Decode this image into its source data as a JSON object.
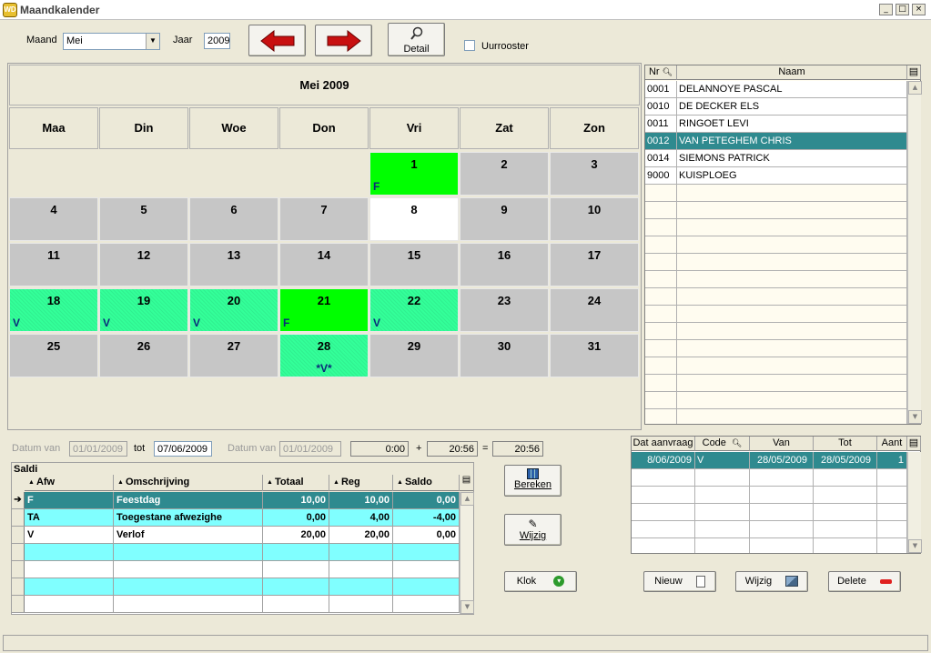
{
  "window": {
    "title": "Maandkalender",
    "min": "_",
    "max": "□",
    "close": "×"
  },
  "toolbar": {
    "maand_label": "Maand",
    "maand_value": "Mei",
    "jaar_label": "Jaar",
    "jaar_value": "2009",
    "detail_label": "Detail",
    "uurrooster_label": "Uurrooster",
    "uurrooster_checked": false
  },
  "calendar": {
    "month_title": "Mei 2009",
    "day_headers": [
      "Maa",
      "Din",
      "Woe",
      "Don",
      "Vri",
      "Zat",
      "Zon"
    ],
    "weeks": [
      [
        {
          "d": "",
          "s": "empty",
          "m": ""
        },
        {
          "d": "",
          "s": "empty",
          "m": ""
        },
        {
          "d": "",
          "s": "empty",
          "m": ""
        },
        {
          "d": "",
          "s": "empty",
          "m": ""
        },
        {
          "d": "1",
          "s": "green",
          "m": "F"
        },
        {
          "d": "2",
          "s": "gray",
          "m": ""
        },
        {
          "d": "3",
          "s": "gray",
          "m": ""
        }
      ],
      [
        {
          "d": "4",
          "s": "gray",
          "m": ""
        },
        {
          "d": "5",
          "s": "gray",
          "m": ""
        },
        {
          "d": "6",
          "s": "gray",
          "m": ""
        },
        {
          "d": "7",
          "s": "gray",
          "m": ""
        },
        {
          "d": "8",
          "s": "white",
          "m": ""
        },
        {
          "d": "9",
          "s": "gray",
          "m": ""
        },
        {
          "d": "10",
          "s": "gray",
          "m": ""
        }
      ],
      [
        {
          "d": "11",
          "s": "gray",
          "m": ""
        },
        {
          "d": "12",
          "s": "gray",
          "m": ""
        },
        {
          "d": "13",
          "s": "gray",
          "m": ""
        },
        {
          "d": "14",
          "s": "gray",
          "m": ""
        },
        {
          "d": "15",
          "s": "gray",
          "m": ""
        },
        {
          "d": "16",
          "s": "gray",
          "m": ""
        },
        {
          "d": "17",
          "s": "gray",
          "m": ""
        }
      ],
      [
        {
          "d": "18",
          "s": "hatch",
          "m": "V"
        },
        {
          "d": "19",
          "s": "hatch",
          "m": "V"
        },
        {
          "d": "20",
          "s": "hatch",
          "m": "V"
        },
        {
          "d": "21",
          "s": "green",
          "m": "F"
        },
        {
          "d": "22",
          "s": "hatch",
          "m": "V"
        },
        {
          "d": "23",
          "s": "gray",
          "m": ""
        },
        {
          "d": "24",
          "s": "gray",
          "m": ""
        }
      ],
      [
        {
          "d": "25",
          "s": "gray",
          "m": ""
        },
        {
          "d": "26",
          "s": "gray",
          "m": ""
        },
        {
          "d": "27",
          "s": "gray",
          "m": ""
        },
        {
          "d": "28",
          "s": "hatch center",
          "m": "*V*"
        },
        {
          "d": "29",
          "s": "gray",
          "m": ""
        },
        {
          "d": "30",
          "s": "gray",
          "m": ""
        },
        {
          "d": "31",
          "s": "gray",
          "m": ""
        }
      ]
    ]
  },
  "employees": {
    "col_nr": "Nr",
    "col_naam": "Naam",
    "rows": [
      {
        "nr": "0001",
        "naam": "DELANNOYE PASCAL"
      },
      {
        "nr": "0010",
        "naam": "DE DECKER ELS"
      },
      {
        "nr": "0011",
        "naam": "RINGOET LEVI"
      },
      {
        "nr": "0012",
        "naam": "VAN PETEGHEM CHRIS"
      },
      {
        "nr": "0014",
        "naam": "SIEMONS PATRICK"
      },
      {
        "nr": "9000",
        "naam": "KUISPLOEG"
      }
    ],
    "selected_index": 3
  },
  "dates": {
    "datum_van_label": "Datum van",
    "datum_van_value": "01/01/2009",
    "tot_label": "tot",
    "tot_value": "07/06/2009",
    "datum_van2_label": "Datum van",
    "datum_van2_value": "01/01/2009",
    "sum1": "0:00",
    "plus": "+",
    "sum2": "20:56",
    "eq": "=",
    "sum3": "20:56"
  },
  "saldi": {
    "title": "Saldi",
    "headers": [
      "Afw",
      "Omschrijving",
      "Totaal",
      "Reg",
      "Saldo"
    ],
    "rows": [
      {
        "afw": "F",
        "oms": "Feestdag",
        "totaal": "10,00",
        "reg": "10,00",
        "saldo": "0,00"
      },
      {
        "afw": "TA",
        "oms": "Toegestane afwezighe",
        "totaal": "0,00",
        "reg": "4,00",
        "saldo": "-4,00"
      },
      {
        "afw": "V",
        "oms": "Verlof",
        "totaal": "20,00",
        "reg": "20,00",
        "saldo": "0,00"
      }
    ]
  },
  "buttons": {
    "bereken": "Bereken",
    "wijzig": "Wijzig",
    "klok": "Klok",
    "nieuw": "Nieuw",
    "wijzig2": "Wijzig",
    "delete": "Delete"
  },
  "aanvraag": {
    "headers": [
      "Dat aanvraag",
      "Code",
      "Van",
      "Tot",
      "Aant"
    ],
    "rows": [
      {
        "dat": "8/06/2009",
        "code": "V",
        "van": "28/05/2009",
        "tot": "28/05/2009",
        "aant": "1"
      }
    ]
  },
  "colors": {
    "selection": "#2f8a8f",
    "holiday_green": "#00ff00",
    "leave_green": "#33ff99",
    "saldi_cyan": "#80ffff"
  }
}
